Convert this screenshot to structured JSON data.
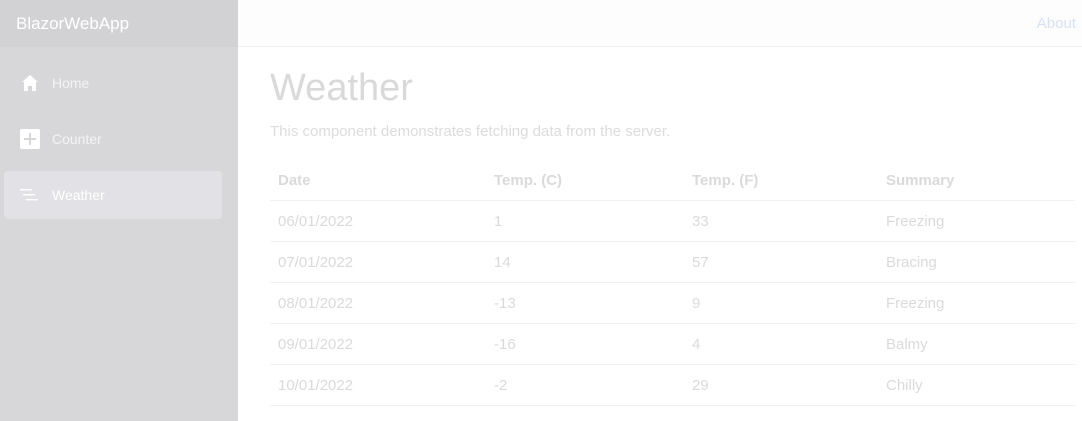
{
  "app": {
    "brand": "BlazorWebApp"
  },
  "nav": {
    "items": [
      {
        "label": "Home",
        "icon": "home-icon"
      },
      {
        "label": "Counter",
        "icon": "plus-square-icon"
      },
      {
        "label": "Weather",
        "icon": "list-lines-icon",
        "active": true
      }
    ]
  },
  "topbar": {
    "about": "About"
  },
  "page": {
    "title": "Weather",
    "description": "This component demonstrates fetching data from the server."
  },
  "table": {
    "headers": [
      "Date",
      "Temp. (C)",
      "Temp. (F)",
      "Summary"
    ],
    "rows": [
      [
        "06/01/2022",
        "1",
        "33",
        "Freezing"
      ],
      [
        "07/01/2022",
        "14",
        "57",
        "Bracing"
      ],
      [
        "08/01/2022",
        "-13",
        "9",
        "Freezing"
      ],
      [
        "09/01/2022",
        "-16",
        "4",
        "Balmy"
      ],
      [
        "10/01/2022",
        "-2",
        "29",
        "Chilly"
      ]
    ]
  },
  "colors": {
    "sidebar_bg": "#d7d7da",
    "active_item_bg": "#e2e2e6",
    "text_light": "#dadada",
    "link": "#d6e2f0"
  }
}
